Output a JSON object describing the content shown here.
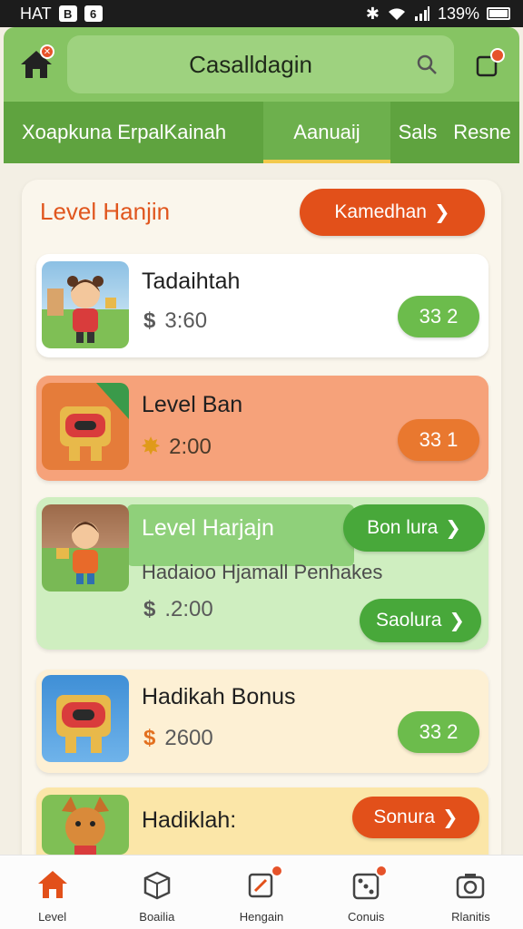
{
  "status_bar": {
    "left_text": "HAT",
    "left_icon_1": "B",
    "left_icon_2": "6",
    "battery_text": "139%"
  },
  "app_bar": {
    "title": "Casalldagin",
    "home_badge": "✕",
    "icons": [
      "home-icon",
      "search-icon",
      "notification-icon"
    ]
  },
  "tabs": [
    {
      "label": "Xoapkuna ErpalKainah"
    },
    {
      "label": "Aanuaij"
    },
    {
      "label": "Sals"
    },
    {
      "label": "Resne"
    }
  ],
  "section": {
    "title": "Level Hanjin",
    "action_label": "Kamedhan"
  },
  "cards": [
    {
      "title": "Tadaihtah",
      "currency": "$",
      "price": "3:60",
      "score": "33 2"
    },
    {
      "title": "Level Ban",
      "currency": "✸",
      "price": "2:00",
      "score": "33 1"
    },
    {
      "title": "Level Harjajn",
      "subtitle": "Hadaioo Hjamall Penhakes",
      "currency": "$",
      "price": ".2:00",
      "button_1": "Bon lura",
      "button_2": "Saolura"
    },
    {
      "title": "Hadikah Bonus",
      "currency": "$",
      "price": "2600",
      "score": "33 2"
    },
    {
      "title": "Hadiklah:",
      "button": "Sonura"
    }
  ],
  "bottom_nav": [
    {
      "label": "Level",
      "icon": "home-icon"
    },
    {
      "label": "Boailia",
      "icon": "box-icon"
    },
    {
      "label": "Hengain",
      "icon": "edit-icon"
    },
    {
      "label": "Conuis",
      "icon": "dice-icon"
    },
    {
      "label": "Rlanitis",
      "icon": "camera-icon"
    }
  ],
  "colors": {
    "green": "#86c463",
    "dark_green": "#5fa33f",
    "orange": "#e2501a",
    "accent_orange": "#e9782f"
  }
}
